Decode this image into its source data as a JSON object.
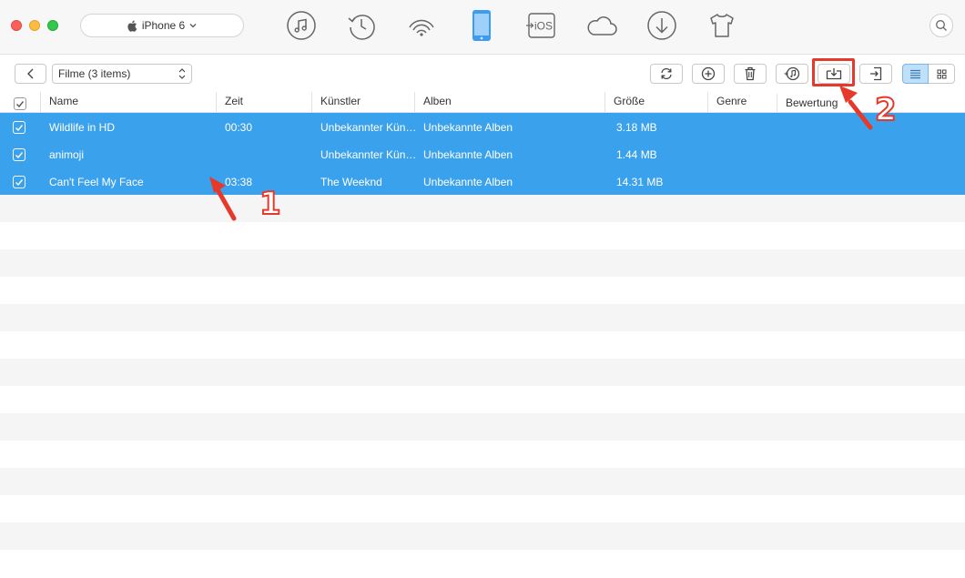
{
  "window": {
    "device_name": "iPhone 6",
    "nav_icons": [
      "music-icon",
      "history-icon",
      "wifi-icon",
      "iphone-icon",
      "to-ios-icon",
      "cloud-icon",
      "download-icon",
      "tshirt-icon"
    ],
    "to_ios_label": "iOS"
  },
  "toolbar": {
    "category": "Filme (3 items)",
    "buttons": [
      "refresh-icon",
      "add-icon",
      "delete-icon",
      "to-itunes-icon",
      "send-to-computer-icon",
      "import-icon"
    ]
  },
  "table": {
    "columns": [
      "Name",
      "Zeit",
      "Künstler",
      "Alben",
      "Größe",
      "Genre",
      "Bewertung"
    ],
    "rows": [
      {
        "name": "Wildlife in HD",
        "time": "00:30",
        "artist": "Unbekannter Kün…",
        "album": "Unbekannte Alben",
        "size": "3.18 MB",
        "genre": "",
        "rating": "",
        "checked": true
      },
      {
        "name": "animoji",
        "time": "",
        "artist": "Unbekannter Kün…",
        "album": "Unbekannte Alben",
        "size": "1.44 MB",
        "genre": "",
        "rating": "",
        "checked": true
      },
      {
        "name": "Can't Feel My Face",
        "time": "03:38",
        "artist": "The Weeknd",
        "album": "Unbekannte Alben",
        "size": "14.31 MB",
        "genre": "",
        "rating": "",
        "checked": true
      }
    ]
  },
  "annotations": {
    "step1": "1",
    "step2": "2"
  },
  "colors": {
    "selection": "#3aa1ec",
    "annotation": "#e53a2b",
    "device_active": "#3d9cf0"
  }
}
